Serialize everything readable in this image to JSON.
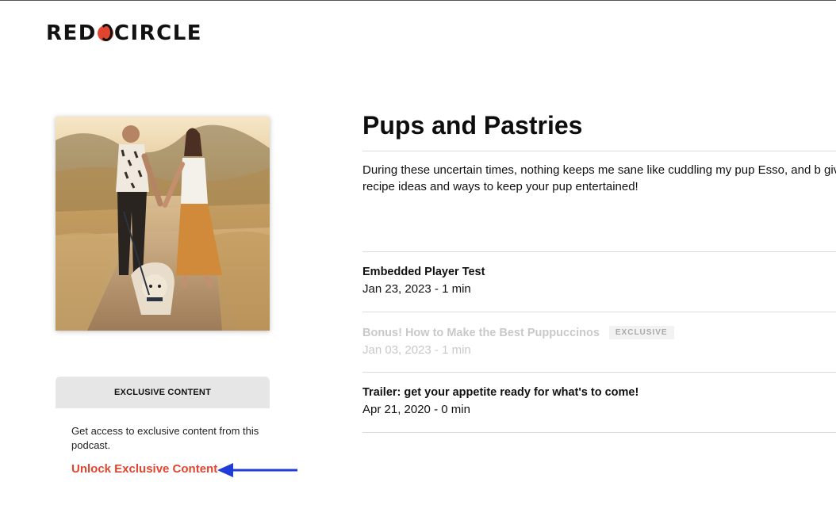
{
  "brand": {
    "logo_left": "RED",
    "logo_right": "CIRCLE",
    "accent": "#e2452f"
  },
  "podcast": {
    "title": "Pups and Pastries",
    "description": "During these uncertain times, nothing keeps me sane like cuddling my pup Esso, and b give you recipe ideas and ways to keep your pup entertained!",
    "cover_alt": "couple walking a dog on a dirt trail"
  },
  "sidebar": {
    "exclusive_header": "EXCLUSIVE CONTENT",
    "exclusive_desc": "Get access to exclusive content from this podcast.",
    "unlock_label": "Unlock Exclusive Content",
    "arrow_color": "#1f3bd8"
  },
  "episodes": [
    {
      "title": "Embedded Player Test",
      "meta": "Jan 23, 2023 - 1 min",
      "locked": false,
      "badge": ""
    },
    {
      "title": "Bonus! How to Make the Best Puppuccinos",
      "meta": "Jan 03, 2023 - 1 min",
      "locked": true,
      "badge": "EXCLUSIVE"
    },
    {
      "title": "Trailer: get your appetite ready for what's to come!",
      "meta": "Apr 21, 2020 - 0 min",
      "locked": false,
      "badge": ""
    }
  ]
}
